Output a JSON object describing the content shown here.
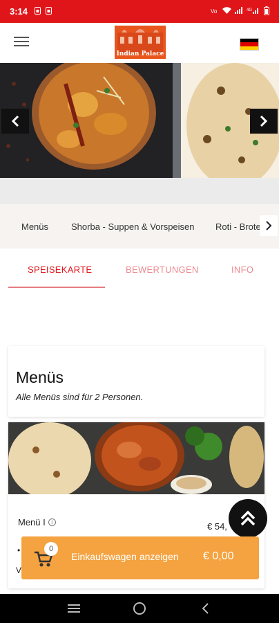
{
  "status_bar": {
    "time": "3:14",
    "icons_left": [
      "sim-icon",
      "sim-icon"
    ],
    "icons_right": [
      "vowifi-icon",
      "wifi-icon",
      "signal-icon",
      "4g-signal-icon",
      "battery-icon"
    ],
    "background": "#e0151a"
  },
  "header": {
    "logo_text": "Indian Palace",
    "logo_icon": "palace-logo-icon",
    "menu_icon": "hamburger-icon",
    "language_flag": "germany-flag-icon"
  },
  "hero": {
    "prev_icon": "chevron-left-icon",
    "next_icon": "chevron-right-icon"
  },
  "categories": {
    "items": [
      "Menüs",
      "Shorba - Suppen & Vorspeisen",
      "Roti - Brote"
    ],
    "more_icon": "chevron-right-icon"
  },
  "tabs": {
    "items": [
      "SPEISEKARTE",
      "BEWERTUNGEN",
      "INFO"
    ],
    "active": "SPEISEKARTE",
    "active_color": "#e0151a",
    "inactive_color": "#ec8a90"
  },
  "section": {
    "title": "Menüs",
    "subtitle": "Alle Menüs sind für 2 Personen."
  },
  "product": {
    "name": "Menü I",
    "price": "€ 54,",
    "bullet": "•",
    "text_fragment": "V"
  },
  "cart": {
    "count": "0",
    "label": "Einkaufswagen anzeigen",
    "total": "€ 0,00",
    "color": "#f4a340"
  },
  "nav_bar": {
    "icons": [
      "recent-apps-icon",
      "home-icon",
      "back-icon"
    ]
  }
}
